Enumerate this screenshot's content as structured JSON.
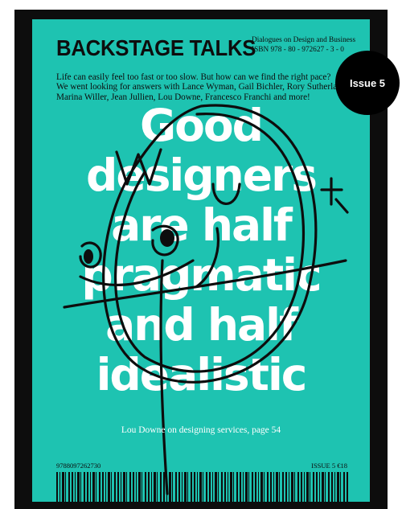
{
  "cover": {
    "brand": "BACKSTAGE TALKS",
    "tagline": "Dialogues on Design and Business",
    "isbn_line": "ISBN 978 - 80 - 972627 - 3 - 0",
    "intro_lines": [
      "Life can easily feel too fast or too slow. But how can we find the right pace?",
      "We went looking for answers with Lance Wyman, Gail Bichler, Rory Sutherland,",
      "Marina Willer, Jean Jullien, Lou Downe, Francesco Franchi and more!"
    ],
    "headline_lines": [
      "Good",
      "designers",
      "are half",
      "pragmatic",
      "and half",
      "idealistic"
    ],
    "caption": "Lou Downe on designing services, page 54",
    "barcode_number": "9788097262730",
    "issue_price": "ISSUE 5  €18",
    "colors": {
      "cover": "#1ec3b1",
      "ink": "#0d0d0d",
      "badge": "#000000"
    }
  },
  "badge": {
    "label": "Issue 5"
  }
}
